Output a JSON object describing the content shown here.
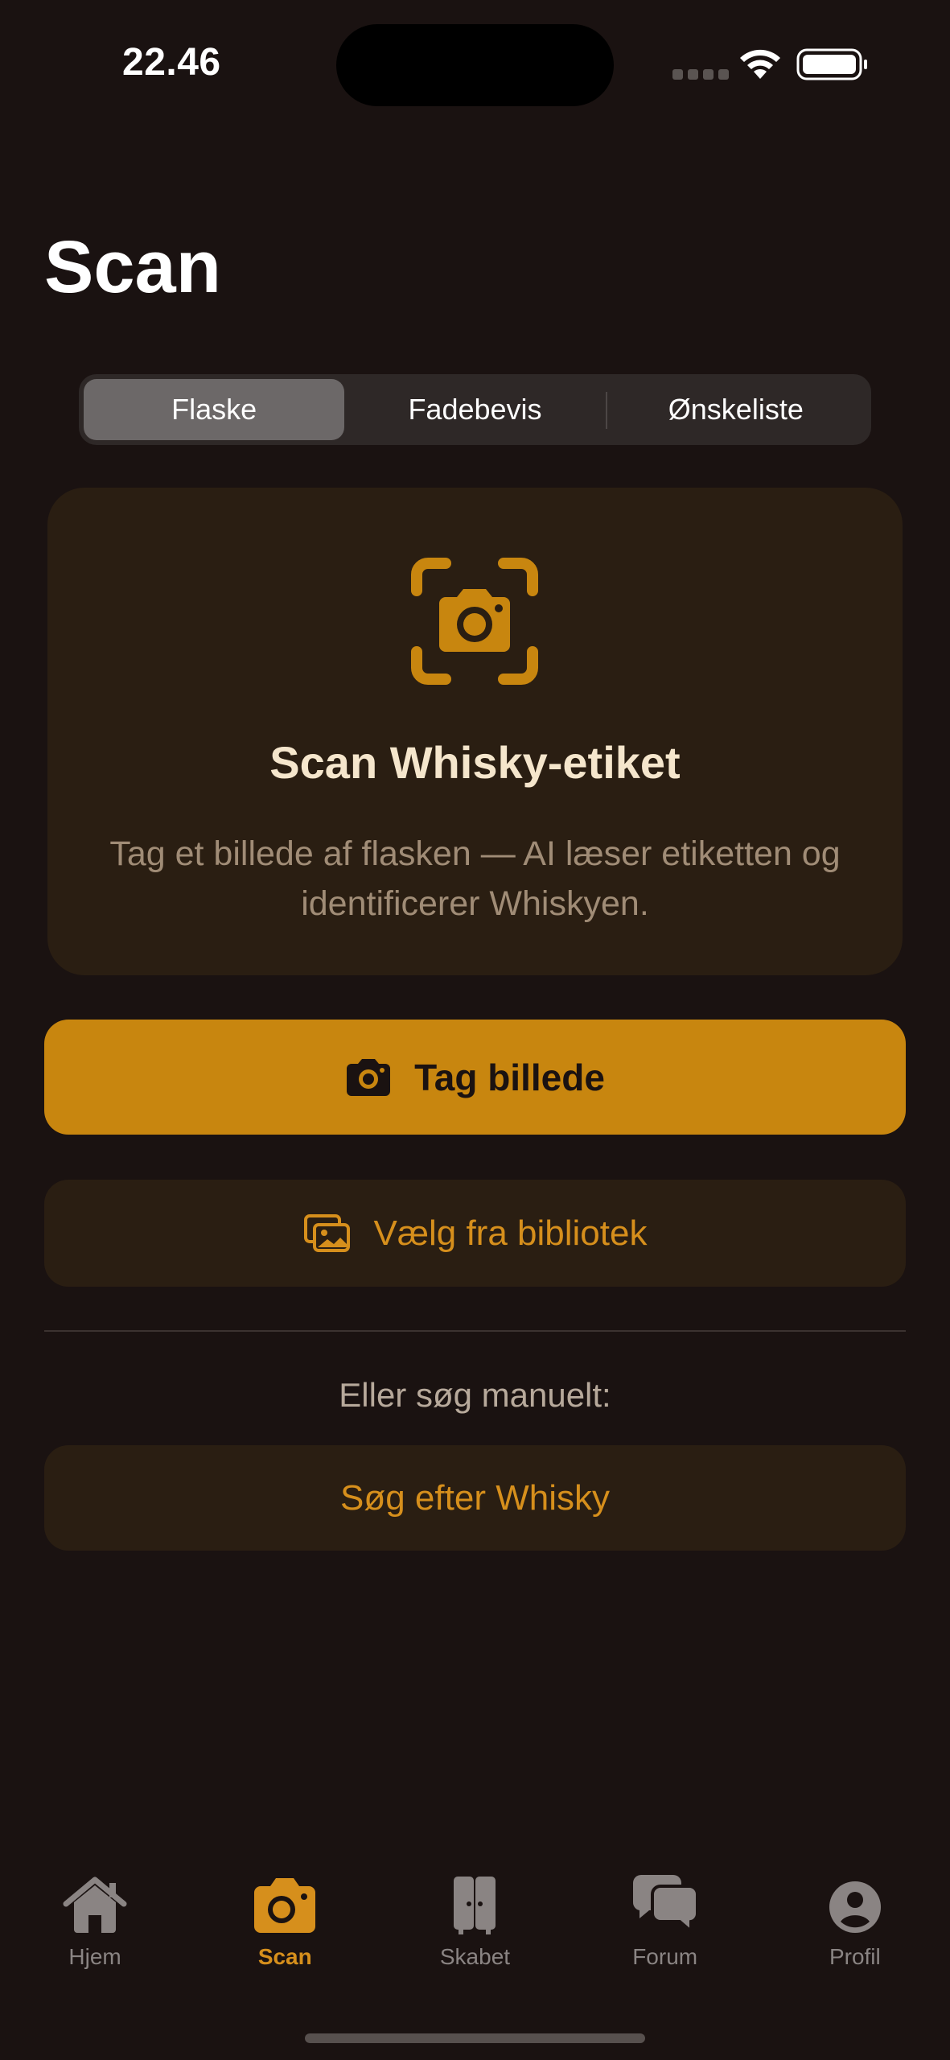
{
  "status_bar": {
    "time": "22.46"
  },
  "page": {
    "title": "Scan"
  },
  "segments": [
    {
      "label": "Flaske",
      "selected": true
    },
    {
      "label": "Fadebevis",
      "selected": false
    },
    {
      "label": "Ønskeliste",
      "selected": false
    }
  ],
  "scan_card": {
    "icon": "camera-viewfinder-icon",
    "title": "Scan Whisky-etiket",
    "description": "Tag et billede af flasken — AI læser etiketten og identificerer Whiskyen."
  },
  "actions": {
    "take_photo_label": "Tag billede",
    "choose_library_label": "Vælg fra bibliotek"
  },
  "manual": {
    "prompt": "Eller søg manuelt:",
    "search_label": "Søg efter Whisky"
  },
  "tabbar": [
    {
      "label": "Hjem",
      "icon": "house-icon",
      "active": false
    },
    {
      "label": "Scan",
      "icon": "camera-icon",
      "active": true
    },
    {
      "label": "Skabet",
      "icon": "cabinet-icon",
      "active": false
    },
    {
      "label": "Forum",
      "icon": "chat-bubbles-icon",
      "active": false
    },
    {
      "label": "Profil",
      "icon": "person-circle-icon",
      "active": false
    }
  ],
  "colors": {
    "background": "#1a1211",
    "accent": "#c8860f",
    "card": "#2a1e12",
    "accent_text": "#d68f1c"
  }
}
